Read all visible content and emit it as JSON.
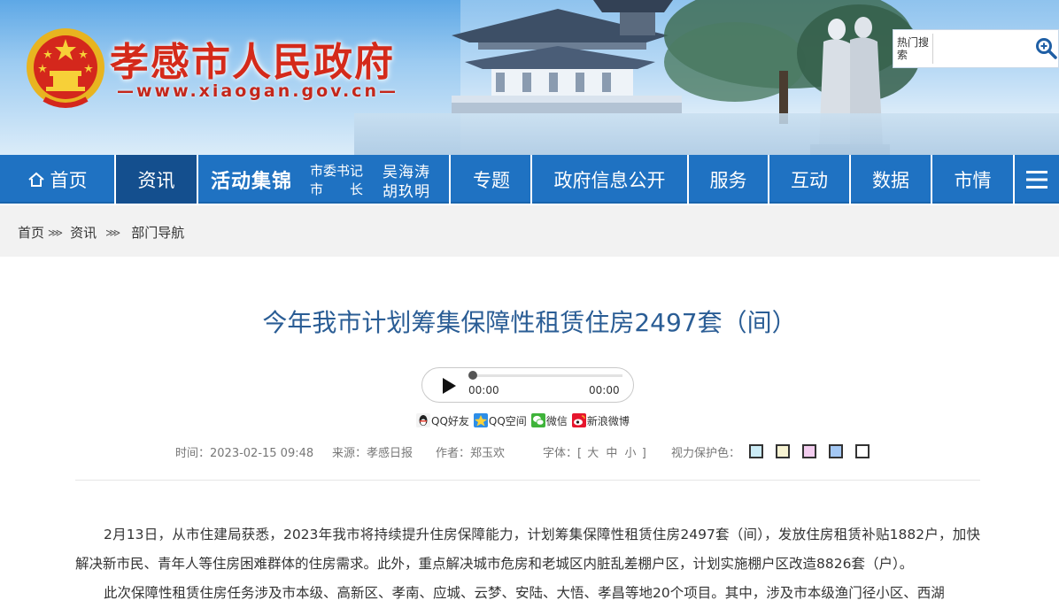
{
  "header": {
    "site_title": "孝感市人民政府",
    "site_url": "—www.xiaogan.gov.cn—",
    "search_label": "热门搜索",
    "search_placeholder": "",
    "emblem_icon": "national-emblem-icon",
    "search_icon": "magnifier-icon"
  },
  "nav": {
    "home": "首页",
    "info": "资讯",
    "campaign_title": "活动集锦",
    "campaign_role_1": "市委书记",
    "campaign_name_1": "吴海涛",
    "campaign_role_2": "市　　长",
    "campaign_name_2": "胡玖明",
    "topic": "专题",
    "gov_info": "政府信息公开",
    "service": "服务",
    "interaction": "互动",
    "data": "数据",
    "city": "市情",
    "menu_icon": "hamburger-menu-icon",
    "active": "资讯"
  },
  "breadcrumb": {
    "items": [
      "首页",
      "资讯",
      "部门导航"
    ],
    "separator": "⋙"
  },
  "article": {
    "title": "今年我市计划筹集保障性租赁住房2497套（间）",
    "player": {
      "current_time": "00:00",
      "total_time": "00:00",
      "progress": 0
    },
    "share": {
      "qq_friend": "QQ好友",
      "qq_zone": "QQ空间",
      "wechat": "微信",
      "weibo": "新浪微博"
    },
    "meta": {
      "time": "时间：2023-02-15 09:48",
      "source": "来源：孝感日报",
      "author": "作者：郑玉欢",
      "font_label": "字体：[",
      "font_large": "大",
      "font_medium": "中",
      "font_small": "小",
      "font_close": "]",
      "eye_label": "视力保护色："
    },
    "eye_colors": [
      "#ccecf6",
      "#f7f3d2",
      "#f3cdef",
      "#a4c8f4",
      "#ffffff"
    ],
    "paragraphs": [
      "2月13日，从市住建局获悉，2023年我市将持续提升住房保障能力，计划筹集保障性租赁住房2497套（间），发放住房租赁补贴1882户，加快解决新市民、青年人等住房困难群体的住房需求。此外，重点解决城市危房和老城区内脏乱差棚户区，计划实施棚户区改造8826套（户）。",
      "此次保障性租赁住房任务涉及市本级、高新区、孝南、应城、云梦、安陆、大悟、孝昌等地20个项目。其中，涉及市本级渔门径小区、西湖"
    ]
  },
  "colors": {
    "nav_bg": "#1f72c2",
    "nav_active": "#144f8e",
    "title_red": "#d42a1a",
    "article_title": "#2a5d95"
  }
}
